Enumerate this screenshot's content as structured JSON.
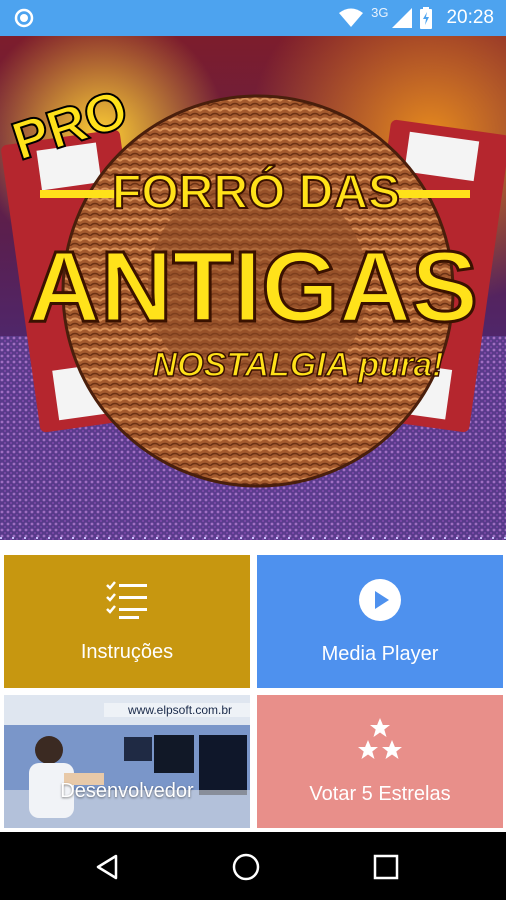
{
  "status_bar": {
    "network_label": "3G",
    "time": "20:28"
  },
  "hero": {
    "badge": "PRO",
    "title_line1": "FORRÓ DAS",
    "title_line2": "ANTIGAS",
    "tagline": "NOSTALGIA pura!"
  },
  "tiles": [
    {
      "label": "Instruções",
      "icon": "checklist-icon",
      "color": "#c79710"
    },
    {
      "label": "Media Player",
      "icon": "play-circle-icon",
      "color": "#4e91ee"
    },
    {
      "label": "Desenvolvedor",
      "photo_text": "www.elpsoft.com.br",
      "color": "#6a8fcb"
    },
    {
      "label": "Votar 5 Estrelas",
      "icon": "stars-icon",
      "color": "#e88f8a"
    }
  ],
  "colors": {
    "status_bar": "#4da3ef",
    "nav_bar": "#000000",
    "title_yellow": "#ffe21a"
  }
}
